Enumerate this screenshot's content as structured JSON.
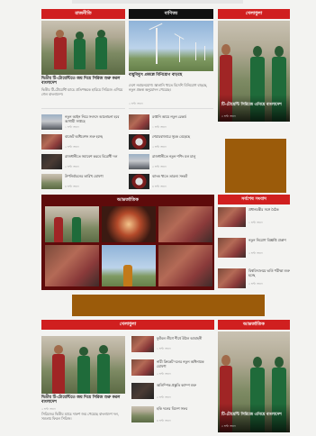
{
  "top_strip": {
    "left": "",
    "right": ""
  },
  "sections": {
    "col1_header": "রাজনীতি",
    "col2_header": "বাণিজ্য",
    "col3_header": "খেলাধুলা",
    "middle_header": "আন্তর্জাতিক",
    "right2_header": "সর্বশেষ সংবাদ",
    "bottom_left_header": "খেলাধুলা",
    "bottom_right_header": "আন্তর্জাতিক"
  },
  "col1_lead": {
    "title": "দ্বিতীয় টি-টোয়েন্টিতে জয় দিয়ে সিরিজ শুরু করল বাংলাদেশ",
    "summary": "দ্বিতীয় টি-টোয়েন্টি ম্যাচে প্রতিপক্ষকে হারিয়ে সিরিজে এগিয়ে গেল বাংলাদেশ।",
    "time": ""
  },
  "col1_list": [
    {
      "title": "নতুন আইন নিয়ে সংসদে আলোচনা হবে আগামী সপ্তাহে",
      "time": "১ ঘণ্টা আগে"
    },
    {
      "title": "বাজেট অধিবেশন শুরু হচ্ছে",
      "time": "২ ঘণ্টা আগে"
    },
    {
      "title": "রাজধানীতে সমাবেশ করবে বিরোধী দল",
      "time": "৩ ঘণ্টা আগে"
    },
    {
      "title": "উপনির্বাচনের তারিখ ঘোষণা",
      "time": "৪ ঘণ্টা আগে"
    }
  ],
  "col2_lead": {
    "title": "বায়ুবিদ্যুৎ প্রকল্পে বিনিয়োগ বাড়ছে",
    "summary": "দেশে নবায়নযোগ্য জ্বালানি খাতে বিদেশি বিনিয়োগ বাড়ছে, নতুন প্রকল্প অনুমোদন পেয়েছে।",
    "time": "২ ঘণ্টা আগে"
  },
  "col2_list": [
    {
      "title": "রপ্তানি আয়ে নতুন রেকর্ড",
      "time": "১ ঘণ্টা আগে"
    },
    {
      "title": "শেয়ারবাজারে সূচক বেড়েছে",
      "time": "২ ঘণ্টা আগে"
    },
    {
      "title": "রাজধানীতে নতুন শপিং মল চালু",
      "time": "৩ ঘণ্টা আগে"
    },
    {
      "title": "ব্যাংক খাতে তারল্য সংকট",
      "time": "৪ ঘণ্টা আগে"
    }
  ],
  "col3_lead": {
    "title": "টি-টোয়েন্টি সিরিজে এগিয়ে বাংলাদেশ",
    "time": "৩ ঘণ্টা আগে"
  },
  "middle_tiles": [
    {
      "label": ""
    },
    {
      "label": ""
    },
    {
      "label": ""
    },
    {
      "label": ""
    },
    {
      "label": ""
    },
    {
      "label": ""
    }
  ],
  "right2_list": [
    {
      "title": "প্রধানমন্ত্রীর সঙ্গে বৈঠক",
      "time": "১ ঘণ্টা আগে"
    },
    {
      "title": "নতুন নিয়োগ বিজ্ঞপ্তি প্রকাশ",
      "time": "২ ঘণ্টা আগে"
    },
    {
      "title": "বিশ্ববিদ্যালয়ে ভর্তি পরীক্ষা শুরু হচ্ছে",
      "time": "৩ ঘণ্টা আগে"
    }
  ],
  "bottom_lead": {
    "title": "দ্বিতীয় টি-টোয়েন্টিতে জয় দিয়ে সিরিজ শুরু করল বাংলাদেশ",
    "summary": "সিরিজের দ্বিতীয় ম্যাচে দারুণ জয় পেয়েছে বাংলাদেশ দল, সমতায় ফিরল সিরিজ।",
    "time": "২ ঘণ্টা আগে"
  },
  "bottom_list": [
    {
      "title": "ফুটবল লীগে শীর্ষে উঠল আবাহনী",
      "time": "১ ঘণ্টা আগে"
    },
    {
      "title": "নারী ক্রিকেট দলের নতুন অধিনায়ক ঘোষণা",
      "time": "২ ঘণ্টা আগে"
    },
    {
      "title": "অলিম্পিক প্রস্তুতি ক্যাম্প শুরু",
      "time": "৩ ঘণ্টা আগে"
    },
    {
      "title": "হকি দলের বিদেশ সফর",
      "time": "৪ ঘণ্টা আগে"
    }
  ],
  "bottom_right_lead": {
    "title": "টি-টোয়েন্টি সিরিজে এগিয়ে বাংলাদেশ",
    "time": "৩ ঘণ্টা আগে"
  },
  "colors": {
    "accent": "#d01f1f",
    "maroon": "#5e0b0b",
    "ad": "#9b5b0a"
  }
}
